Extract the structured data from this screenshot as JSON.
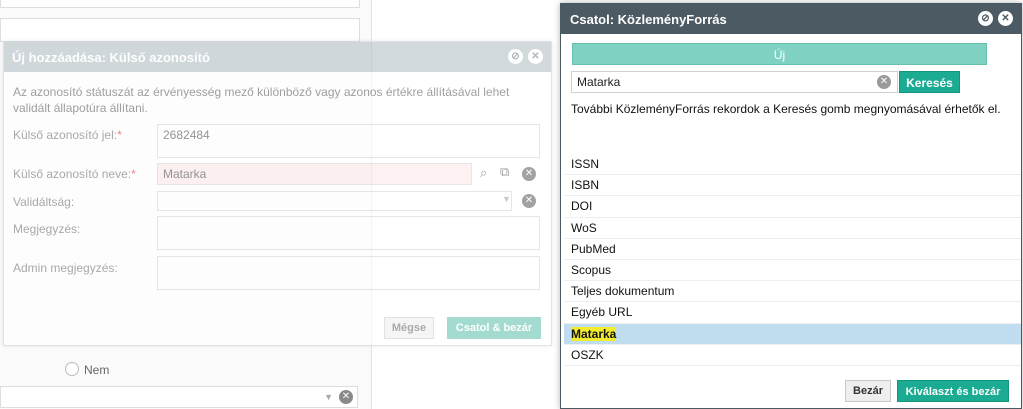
{
  "background": {
    "radio_label": "Nem"
  },
  "add_dialog": {
    "title": "Új hozzáadása: Külső azonosító",
    "info": "Az azonosító státuszát az érvényesség mező különböző vagy azonos értékre állításával lehet validált állapotúra állítani.",
    "fields": {
      "external_id_label": "Külső azonosító jel:",
      "external_id_value": "2682484",
      "external_name_label": "Külső azonosító neve:",
      "external_name_value": "Matarka",
      "validity_label": "Validáltság:",
      "validity_value": "",
      "note_label": "Megjegyzés:",
      "admin_note_label": "Admin megjegyzés:",
      "required_mark": "*"
    },
    "buttons": {
      "cancel": "Mégse",
      "attach_close": "Csatol & bezár"
    }
  },
  "attach_dialog": {
    "title": "Csatol: KözleményForrás",
    "new_button": "Új",
    "search": {
      "value": "Matarka",
      "button": "Keresés"
    },
    "hint": "További KözleményForrás rekordok a Keresés gomb megnyomásával érhetők el.",
    "items": [
      {
        "label": "ISSN",
        "selected": false
      },
      {
        "label": "ISBN",
        "selected": false
      },
      {
        "label": "DOI",
        "selected": false
      },
      {
        "label": "WoS",
        "selected": false
      },
      {
        "label": "PubMed",
        "selected": false
      },
      {
        "label": "Scopus",
        "selected": false
      },
      {
        "label": "Teljes dokumentum",
        "selected": false
      },
      {
        "label": "Egyéb URL",
        "selected": false
      },
      {
        "label": "Matarka",
        "selected": true
      },
      {
        "label": "OSZK",
        "selected": false
      }
    ],
    "buttons": {
      "close": "Bezár",
      "select_close": "Kiválaszt és bezár"
    }
  },
  "colors": {
    "accent": "#1aab92",
    "accent_light": "#7fd1c1",
    "title_bar": "#4c5a63",
    "selection": "#c0dcef",
    "highlight": "#f3ec2c"
  }
}
